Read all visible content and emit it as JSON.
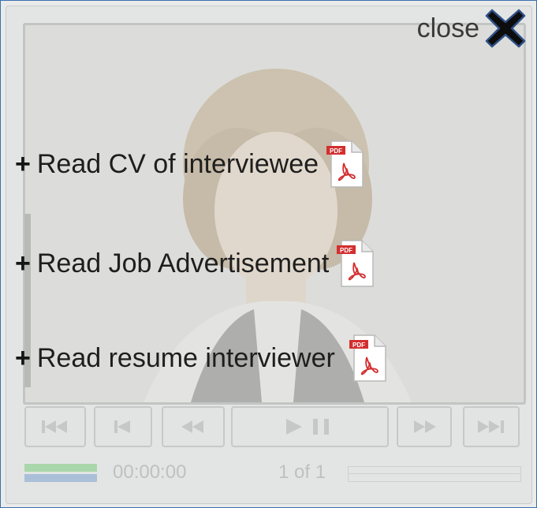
{
  "close": {
    "label": "close",
    "icon": "close-x-icon"
  },
  "links": [
    {
      "label": "Read CV of interviewee",
      "icon": "pdf-file-icon"
    },
    {
      "label": "Read Job Advertisement",
      "icon": "pdf-file-icon"
    },
    {
      "label": "Read resume interviewer",
      "icon": "pdf-file-icon"
    }
  ],
  "link_prefix": "+",
  "player": {
    "time": "00:00:00",
    "counter": "1 of 1",
    "buttons": [
      "skip-to-start",
      "previous",
      "rewind",
      "play-pause",
      "fast-forward",
      "skip-to-end"
    ]
  },
  "colors": {
    "accent_border": "#3b6fb0",
    "pdf_red": "#d32f2f",
    "volume_green": "#a9d7ab",
    "volume_blue": "#aac0d8"
  }
}
